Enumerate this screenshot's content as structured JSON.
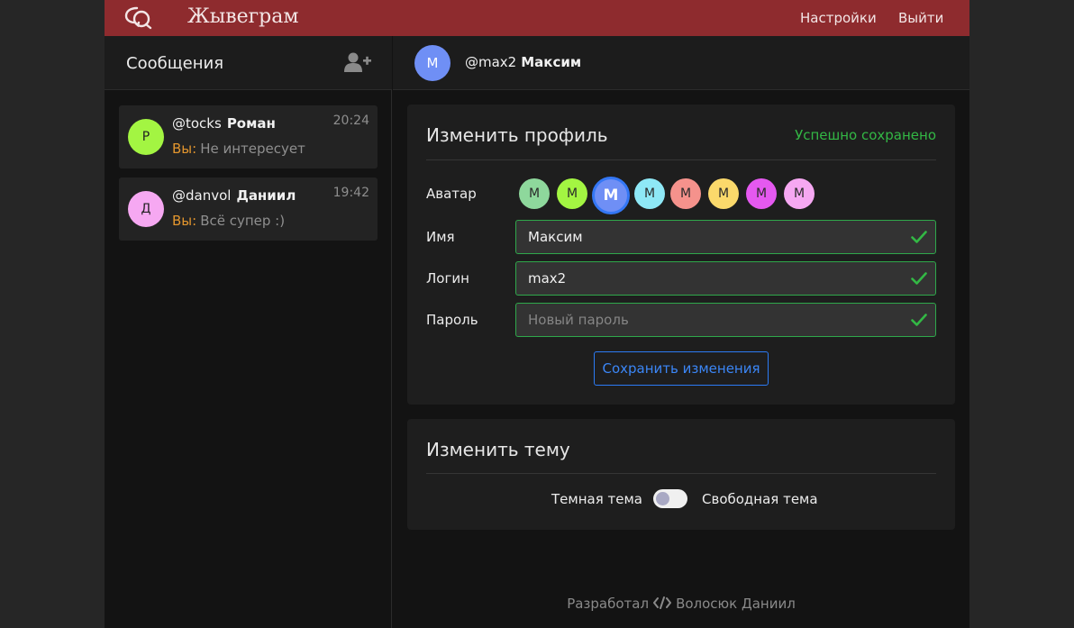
{
  "header": {
    "brand": "Жывеграм",
    "settings_label": "Настройки",
    "logout_label": "Выйти"
  },
  "sidebar": {
    "title": "Сообщения",
    "chats": [
      {
        "avatar_letter": "Р",
        "avatar_color": "#a3f542",
        "username": "@tocks",
        "name": "Роман",
        "time": "20:24",
        "you_label": "Вы:",
        "preview": "Не интересует"
      },
      {
        "avatar_letter": "Д",
        "avatar_color": "#f6a8f2",
        "username": "@danvol",
        "name": "Даниил",
        "time": "19:42",
        "you_label": "Вы:",
        "preview": "Всё супер :)"
      }
    ]
  },
  "main": {
    "avatar_letter": "М",
    "avatar_color": "#6f8ff5",
    "username": "@max2",
    "name": "Максим"
  },
  "profile": {
    "title": "Изменить профиль",
    "status": "Успешно сохранено",
    "avatar_label": "Аватар",
    "avatar_letter": "М",
    "avatar_colors": [
      "#8ed89c",
      "#a3f542",
      "#6f8ff5",
      "#8ee8f6",
      "#f5928c",
      "#fbd96b",
      "#e559f0",
      "#f6a8f2"
    ],
    "selected_avatar_index": 2,
    "name_label": "Имя",
    "name_value": "Максим",
    "login_label": "Логин",
    "login_value": "max2",
    "password_label": "Пароль",
    "password_placeholder": "Новый пароль",
    "save_label": "Сохранить изменения"
  },
  "theme": {
    "title": "Изменить тему",
    "dark_label": "Темная тема",
    "free_label": "Свободная тема",
    "dark_enabled": false
  },
  "footer": {
    "prefix": "Разработал",
    "author": "Волосюк Даниил"
  },
  "colors": {
    "accent": "#8e2b2e",
    "success": "#33b845",
    "link": "#3b86f6",
    "you_label": "#e3962e"
  }
}
